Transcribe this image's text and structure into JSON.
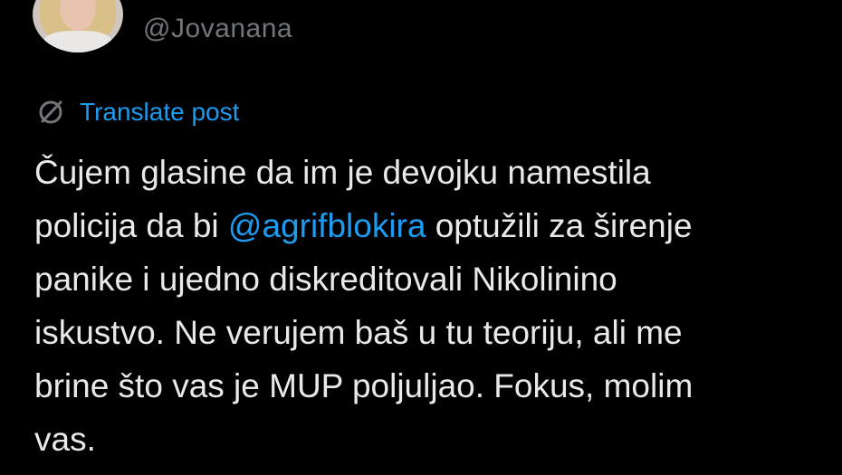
{
  "author": {
    "handle": "@Jovanana",
    "avatar_icon": "user-avatar-photo"
  },
  "translate": {
    "icon": "globe-slash-icon",
    "label": "Translate post"
  },
  "tweet": {
    "line1": "Čujem glasine da im je devojku namestila",
    "line2_before": "policija da bi ",
    "mention": "@agrifblokira",
    "line2_after": " optužili za širenje",
    "line3": "panike i ujedno diskreditovali Nikolinino",
    "line4": "iskustvo. Ne verujem baš u tu teoriju, ali me",
    "line5": "brine što vas je MUP poljuljao. Fokus, molim",
    "line6": "vas."
  },
  "colors": {
    "background": "#000000",
    "text": "#e7e9ea",
    "secondary": "#71767b",
    "link": "#1d9bf0"
  }
}
